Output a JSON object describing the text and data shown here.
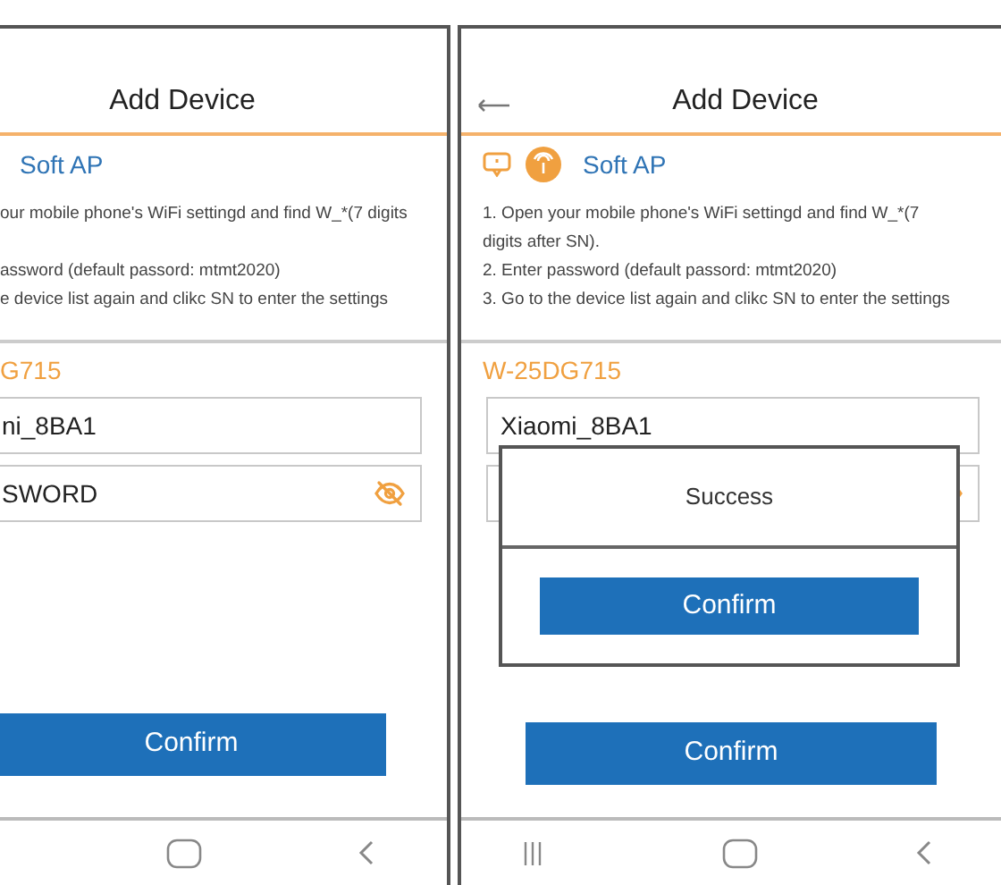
{
  "screens": [
    {
      "cropped": true,
      "back_button": false,
      "title": "Add Device",
      "mode_label": "Soft AP",
      "instructions": [
        "our mobile phone's WiFi settingd and find W_*(7 digits",
        "assword (default passord: mtmt2020)",
        "e device list again and clikc SN to enter the settings"
      ],
      "device_name": "G715",
      "fields": [
        {
          "kind": "text",
          "value": "ni_8BA1"
        },
        {
          "kind": "password",
          "value": "SWORD"
        }
      ],
      "confirm": "Confirm",
      "recents_button": false
    },
    {
      "cropped": false,
      "back_button": true,
      "title": "Add Device",
      "mode_label": "Soft AP",
      "instructions": [
        "1. Open your mobile phone's WiFi settingd and find W_*(7 digits after SN).",
        "2. Enter password (default passord: mtmt2020)",
        "3. Go to the device list again and clikc SN to enter the settings"
      ],
      "device_name": "W-25DG715",
      "fields": [
        {
          "kind": "text",
          "value": "Xiaomi_8BA1"
        },
        {
          "kind": "password"
        }
      ],
      "confirm": "Confirm",
      "recents_button": true,
      "dialog": {
        "message": "Success",
        "button": "Confirm"
      }
    }
  ]
}
